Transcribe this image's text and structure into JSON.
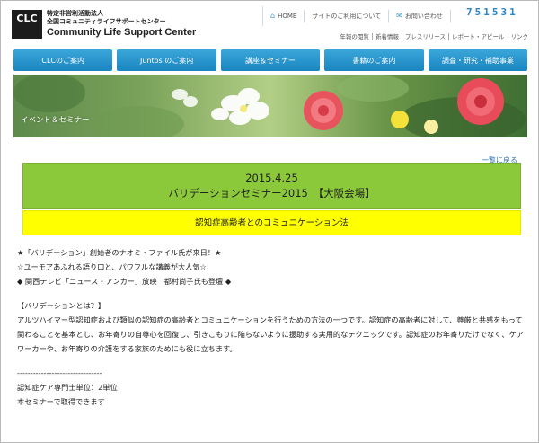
{
  "header": {
    "logo_mark": "CLC",
    "logo_line1": "特定非営利活動法人",
    "logo_line2": "全国コミュニティライフサポートセンター",
    "logo_line3": "Community Life Support Center",
    "util_home": "HOME",
    "util_terms": "サイトのご利用について",
    "util_contact": "お問い合わせ",
    "counter": "751531",
    "sublinks": [
      "年報の閲覧",
      "新着情報",
      "プレスリリース",
      "レポート・アピール",
      "リンク"
    ]
  },
  "nav": {
    "items": [
      "CLCのご案内",
      "Juntos のご案内",
      "講座＆セミナー",
      "書籍のご案内",
      "調査・研究・補助事業"
    ]
  },
  "banner": {
    "label": "イベント＆セミナー"
  },
  "back_link": "一覧に戻る",
  "event": {
    "date": "2015.4.25",
    "title": "バリデーションセミナー2015　【大阪会場】",
    "subtitle": "認知症高齢者とのコミュニケーション法"
  },
  "body": {
    "line1": "★「バリデーション」創始者のナオミ・ファイル氏が来日！★",
    "line2": "☆ユーモアあふれる語り口と、パワフルな講義が大人気☆",
    "line3": "◆ 関西テレビ「ニュース・アンカー」放映　都村尚子氏も登壇 ◆",
    "heading": "【バリデーションとは？】",
    "para": "アルツハイマー型認知症および類似の認知症の高齢者とコミュニケーションを行うための方法の一つです。認知症の高齢者に対して、尊厳と共感をもって関わることを基本とし、お年寄りの自尊心を回復し、引きこもりに陥らないように援助する実用的なテクニックです。認知症のお年寄りだけでなく、ケアワーカーや、お年寄りの介護をする家族のためにも役に立ちます。",
    "divider": "--------------------------------",
    "credit1": "認知症ケア専門士単位：2単位",
    "credit2": "本セミナーで取得できます"
  }
}
